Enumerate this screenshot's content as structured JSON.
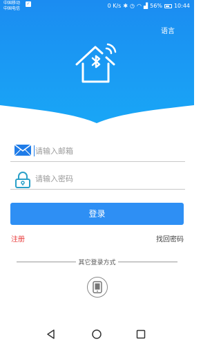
{
  "status_bar": {
    "carrier_1": "中国移动",
    "carrier_2": "中国电信",
    "network_speed": "0 K/s",
    "battery": "56%",
    "time": "10:44"
  },
  "header": {
    "language_label": "语言",
    "gradient_top": "#1c8ff2",
    "gradient_bottom": "#1aa2f5",
    "logo_icon": "bluetooth-house-icon"
  },
  "form": {
    "email_placeholder": "请输入邮箱",
    "email_value": "",
    "password_placeholder": "请输入密码",
    "password_value": "",
    "login_label": "登录",
    "register_label": "注册",
    "forgot_label": "找回密码"
  },
  "other_login": {
    "label": "其它登录方式",
    "phone_icon": "phone-icon"
  },
  "colors": {
    "accent": "#2e8ff4",
    "register": "#e83b3b",
    "email_icon": "#1f7ce8",
    "lock_icon": "#2aa0c8"
  }
}
